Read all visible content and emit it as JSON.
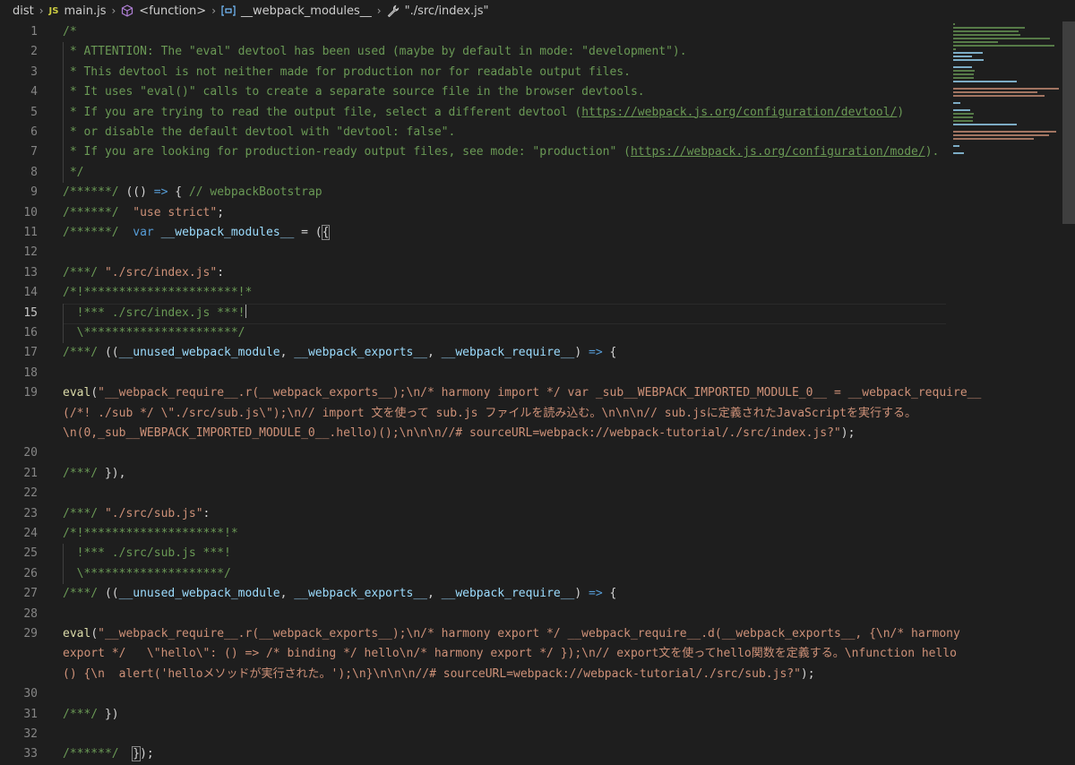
{
  "breadcrumb": {
    "folder": "dist",
    "file_icon": "JS",
    "file": "main.js",
    "func": "<function>",
    "var": "__webpack_modules__",
    "module": "\"./src/index.js\""
  },
  "lines": [
    {
      "n": "1",
      "t": "/*"
    },
    {
      "n": "2",
      "t": " * ATTENTION: The \"eval\" devtool has been used (maybe by default in mode: \"development\")."
    },
    {
      "n": "3",
      "t": " * This devtool is not neither made for production nor for readable output files."
    },
    {
      "n": "4",
      "t": " * It uses \"eval()\" calls to create a separate source file in the browser devtools."
    },
    {
      "n": "5",
      "t": " * If you are trying to read the output file, select a different devtool (https://webpack.js.org/configuration/devtool/)"
    },
    {
      "n": "6",
      "t": " * or disable the default devtool with \"devtool: false\"."
    },
    {
      "n": "7",
      "t": " * If you are looking for production-ready output files, see mode: \"production\" (https://webpack.js.org/configuration/mode/)."
    },
    {
      "n": "8",
      "t": " */"
    },
    {
      "n": "9",
      "t": "/******/ (() => { // webpackBootstrap"
    },
    {
      "n": "10",
      "t": "/******/  \"use strict\";"
    },
    {
      "n": "11",
      "t": "/******/  var __webpack_modules__ = ({"
    },
    {
      "n": "12",
      "t": ""
    },
    {
      "n": "13",
      "t": "/***/ \"./src/index.js\":"
    },
    {
      "n": "14",
      "t": "/*!**********************!*"
    },
    {
      "n": "15",
      "t": "  !*** ./src/index.js ***!"
    },
    {
      "n": "16",
      "t": "  \\**********************/"
    },
    {
      "n": "17",
      "t": "/***/ ((__unused_webpack_module, __webpack_exports__, __webpack_require__) => {"
    },
    {
      "n": "18",
      "t": ""
    },
    {
      "n": "19",
      "t": "eval(\"__webpack_require__.r(__webpack_exports__);\\n/* harmony import */ var _sub__WEBPACK_IMPORTED_MODULE_0__ = __webpack_require__"
    },
    {
      "n": "",
      "t": "(/*! ./sub */ \\\"./src/sub.js\\\");\\n// import 文を使って sub.js ファイルを読み込む。\\n\\n\\n// sub.jsに定義されたJavaScriptを実行する。"
    },
    {
      "n": "",
      "t": "\\n(0,_sub__WEBPACK_IMPORTED_MODULE_0__.hello)();\\n\\n\\n//# sourceURL=webpack://webpack-tutorial/./src/index.js?\");"
    },
    {
      "n": "20",
      "t": ""
    },
    {
      "n": "21",
      "t": "/***/ }),"
    },
    {
      "n": "22",
      "t": ""
    },
    {
      "n": "23",
      "t": "/***/ \"./src/sub.js\":"
    },
    {
      "n": "24",
      "t": "/*!********************!*"
    },
    {
      "n": "25",
      "t": "  !*** ./src/sub.js ***!"
    },
    {
      "n": "26",
      "t": "  \\********************/"
    },
    {
      "n": "27",
      "t": "/***/ ((__unused_webpack_module, __webpack_exports__, __webpack_require__) => {"
    },
    {
      "n": "28",
      "t": ""
    },
    {
      "n": "29",
      "t": "eval(\"__webpack_require__.r(__webpack_exports__);\\n/* harmony export */ __webpack_require__.d(__webpack_exports__, {\\n/* harmony"
    },
    {
      "n": "",
      "t": "export */   \\\"hello\\\": () => /* binding */ hello\\n/* harmony export */ });\\n// export文を使ってhello関数を定義する。\\nfunction hello"
    },
    {
      "n": "",
      "t": "() {\\n  alert('helloメソッドが実行された。');\\n}\\n\\n\\n//# sourceURL=webpack://webpack-tutorial/./src/sub.js?\");"
    },
    {
      "n": "30",
      "t": ""
    },
    {
      "n": "31",
      "t": "/***/ })"
    },
    {
      "n": "32",
      "t": ""
    },
    {
      "n": "33",
      "t": "/******/  });"
    }
  ],
  "active_line": "15",
  "colors": {
    "background": "#1e1e1e",
    "comment": "#6a9955",
    "string": "#ce9178",
    "keyword": "#569cd6",
    "variable": "#9cdcfe",
    "line_number": "#858585"
  }
}
